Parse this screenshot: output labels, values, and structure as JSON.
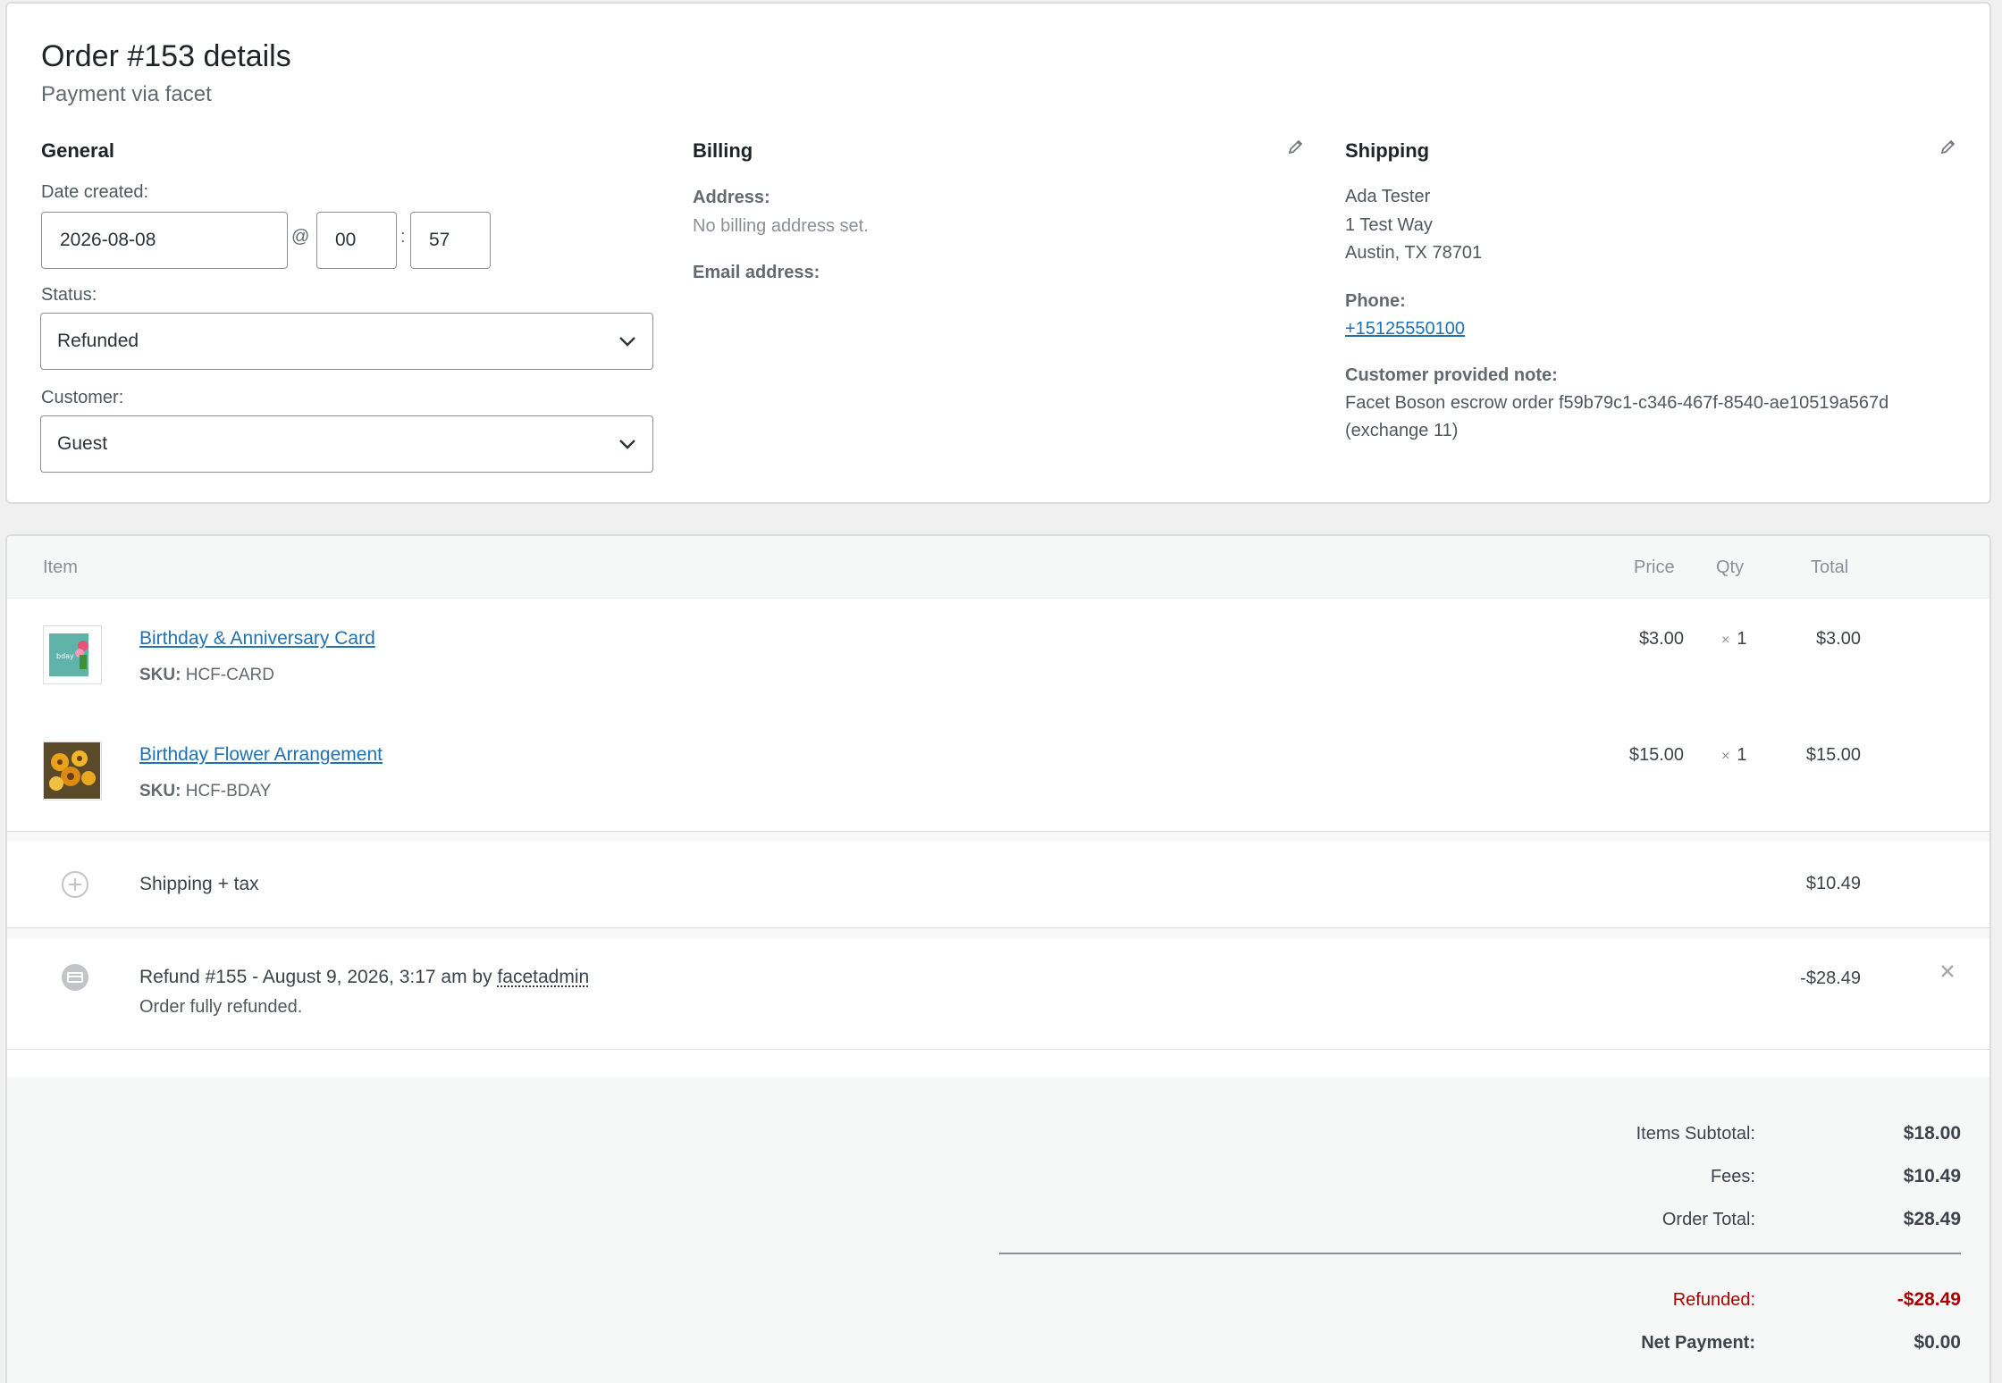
{
  "order": {
    "title": "Order #153 details",
    "subtitle": "Payment via facet"
  },
  "general": {
    "heading": "General",
    "date_label": "Date created:",
    "date_value": "2026-08-08",
    "at": "@",
    "hour": "00",
    "colon": ":",
    "minute": "57",
    "status_label": "Status:",
    "status_value": "Refunded",
    "customer_label": "Customer:",
    "customer_value": "Guest"
  },
  "billing": {
    "heading": "Billing",
    "address_label": "Address:",
    "address_value": "No billing address set.",
    "email_label": "Email address:",
    "edit_icon": "pencil-icon"
  },
  "shipping": {
    "heading": "Shipping",
    "name": "Ada Tester",
    "street": "1 Test Way",
    "city": "Austin, TX 78701",
    "phone_label": "Phone:",
    "phone": "+15125550100",
    "note_label": "Customer provided note:",
    "note_line1": "Facet Boson escrow order f59b79c1-c346-467f-8540-ae10519a567d",
    "note_line2": "(exchange 11)",
    "edit_icon": "pencil-icon"
  },
  "items": {
    "headers": {
      "item": "Item",
      "price": "Price",
      "qty": "Qty",
      "total": "Total"
    },
    "rows": [
      {
        "name": "Birthday & Anniversary Card",
        "sku_label": "SKU:",
        "sku": "HCF-CARD",
        "price": "$3.00",
        "qty_x": "×",
        "qty": "1",
        "total": "$3.00"
      },
      {
        "name": "Birthday Flower Arrangement",
        "sku_label": "SKU:",
        "sku": "HCF-BDAY",
        "price": "$15.00",
        "qty_x": "×",
        "qty": "1",
        "total": "$15.00"
      }
    ]
  },
  "fee": {
    "label": "Shipping + tax",
    "amount": "$10.49",
    "icon": "plus-circle-icon"
  },
  "refund": {
    "title_prefix": "Refund #155 - August 9, 2026, 3:17 am by ",
    "user": "facetadmin",
    "reason": "Order fully refunded.",
    "amount": "-$28.49",
    "delete_icon": "close-icon",
    "icon": "refund-circle-icon"
  },
  "totals": {
    "subtotal_label": "Items Subtotal:",
    "subtotal": "$18.00",
    "fees_label": "Fees:",
    "fees": "$10.49",
    "order_total_label": "Order Total:",
    "order_total": "$28.49",
    "refunded_label": "Refunded:",
    "refunded": "-$28.49",
    "net_label": "Net Payment:",
    "net": "$0.00"
  },
  "colors": {
    "link": "#2271b1",
    "refund_red": "#aa0000",
    "text": "#3c434a"
  }
}
